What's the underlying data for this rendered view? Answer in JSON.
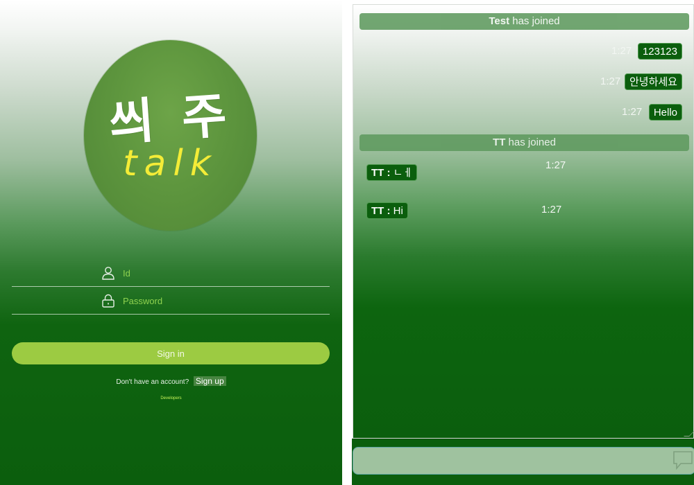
{
  "login": {
    "logo": {
      "hangul": "씌 주",
      "talk": "talk"
    },
    "id_placeholder": "Id",
    "password_placeholder": "Password",
    "signin_label": "Sign in",
    "account_prompt": "Don't have an account?",
    "signup_label": "Sign up",
    "developers_label": "Developers",
    "icons": [
      "user-icon",
      "lock-icon"
    ]
  },
  "chat": {
    "joins": [
      {
        "name": "Test",
        "text": " has joined"
      },
      {
        "name": "TT",
        "text": " has joined"
      }
    ],
    "my_messages": [
      {
        "time": "1:27",
        "text": "123123"
      },
      {
        "time": "1:27",
        "text": "안녕하세요"
      },
      {
        "time": "1:27",
        "text": "Hello"
      }
    ],
    "other_messages": [
      {
        "sender": "TT",
        "sep": " : ",
        "text": "ㄴㅔ",
        "time": "1:27"
      },
      {
        "sender": "TT",
        "sep": " : ",
        "text": "Hi",
        "time": "1:27"
      }
    ],
    "input_value": "",
    "send_icon": "chat-bubble-icon"
  },
  "colors": {
    "dark_green": "#0b5e0d",
    "lime": "#9ccb42",
    "yellow": "#f4ec37"
  }
}
